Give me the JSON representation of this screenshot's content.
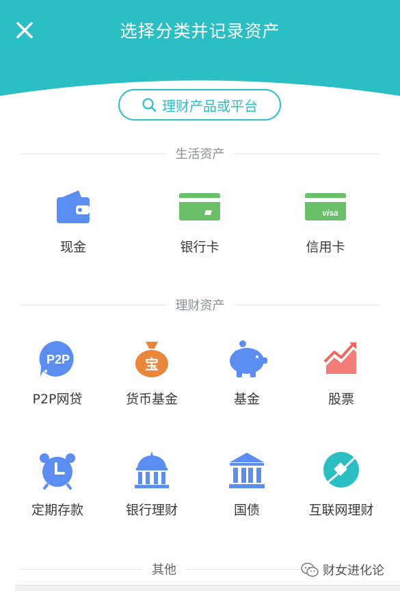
{
  "colors": {
    "accent": "#2bbfc4",
    "icon_blue": "#5b8ef0",
    "icon_green": "#6abf69",
    "icon_orange": "#e8863c",
    "icon_red": "#ee6661"
  },
  "header": {
    "title": "选择分类并记录资产",
    "close_icon": "close-icon"
  },
  "search": {
    "placeholder": "理财产品或平台",
    "icon": "search-icon"
  },
  "sections": {
    "life": {
      "title": "生活资产",
      "items": [
        {
          "label": "现金",
          "icon": "wallet-icon"
        },
        {
          "label": "银行卡",
          "icon": "bank-card-icon"
        },
        {
          "label": "信用卡",
          "icon": "credit-card-icon",
          "icon_text": "visa"
        }
      ]
    },
    "finance": {
      "title": "理财资产",
      "items": [
        {
          "label": "P2P网贷",
          "icon": "p2p-icon",
          "icon_text": "P2P"
        },
        {
          "label": "货币基金",
          "icon": "money-bag-icon",
          "icon_text": "宝"
        },
        {
          "label": "基金",
          "icon": "piggy-bank-icon"
        },
        {
          "label": "股票",
          "icon": "stock-chart-icon"
        },
        {
          "label": "定期存款",
          "icon": "alarm-clock-icon"
        },
        {
          "label": "银行理财",
          "icon": "bank-dome-icon"
        },
        {
          "label": "国债",
          "icon": "government-building-icon"
        },
        {
          "label": "互联网理财",
          "icon": "internet-planet-icon"
        }
      ]
    },
    "other": {
      "title": "其他"
    }
  },
  "watermark": {
    "text": "财女进化论",
    "icon": "wechat-icon"
  }
}
